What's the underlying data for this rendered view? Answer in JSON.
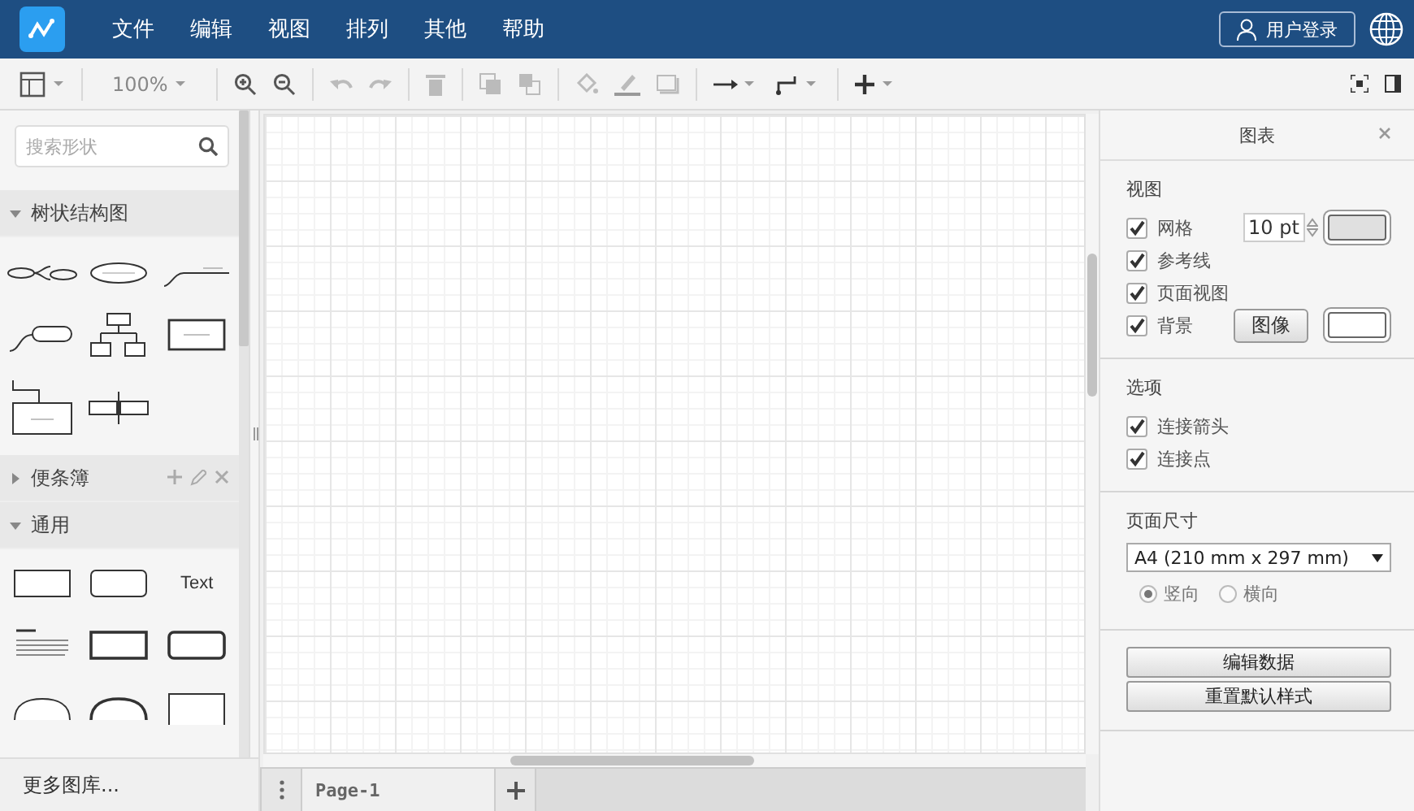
{
  "menu": [
    {
      "label": "文件"
    },
    {
      "label": "编辑"
    },
    {
      "label": "视图"
    },
    {
      "label": "排列"
    },
    {
      "label": "其他"
    },
    {
      "label": "帮助"
    }
  ],
  "login": "用户登录",
  "toolbar": {
    "zoom": "100%"
  },
  "sidebar": {
    "search": {
      "placeholder": "搜索形状"
    },
    "sections": [
      {
        "title": "树状结构图",
        "expanded": true,
        "kind": "tree"
      },
      {
        "title": "便条簿",
        "expanded": false,
        "kind": "scratchpad"
      },
      {
        "title": "通用",
        "expanded": true,
        "kind": "general",
        "text_shape": "Text"
      }
    ],
    "more": "更多图库..."
  },
  "panel": {
    "title": "图表",
    "view": {
      "title": "视图",
      "options": [
        {
          "label": "网格",
          "checked": true,
          "kind": "grid",
          "value": "10 pt"
        },
        {
          "label": "参考线",
          "checked": true,
          "kind": "plain"
        },
        {
          "label": "页面视图",
          "checked": true,
          "kind": "plain"
        },
        {
          "label": "背景",
          "checked": true,
          "kind": "background",
          "button": "图像"
        }
      ]
    },
    "options": {
      "title": "选项",
      "options": [
        {
          "label": "连接箭头",
          "checked": true
        },
        {
          "label": "连接点",
          "checked": true
        }
      ]
    },
    "page_size": {
      "title": "页面尺寸",
      "value": "A4 (210 mm x 297 mm)",
      "orientation": [
        {
          "label": "竖向",
          "selected": true
        },
        {
          "label": "横向",
          "selected": false
        }
      ]
    },
    "buttons": [
      "编辑数据",
      "重置默认样式"
    ]
  },
  "pages": [
    {
      "label": "Page-1",
      "selected": true
    }
  ]
}
